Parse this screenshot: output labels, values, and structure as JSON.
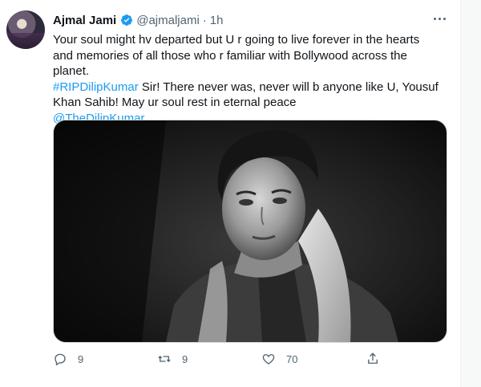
{
  "tweet": {
    "author_name": "Ajmal Jami",
    "handle": "@ajmaljami",
    "separator": "·",
    "time": "1h",
    "text_part1": "Your soul might hv departed but U r going to live forever in the hearts and memories of all those who r familiar with Bollywood across the planet.",
    "hashtag": "#RIPDilipKumar",
    "text_part2": " Sir! There never was, never will b anyone like U, Yousuf Khan Sahib! May ur soul rest in eternal peace",
    "mention": "@TheDilipKumar"
  },
  "actions": {
    "reply_count": "9",
    "retweet_count": "9",
    "like_count": "70"
  },
  "colors": {
    "link": "#1d9bf0",
    "secondary_text": "#536471",
    "verified": "#1d9bf0"
  },
  "icons": [
    "verified-badge-icon",
    "more-options-icon",
    "reply-icon",
    "retweet-icon",
    "like-icon",
    "share-icon"
  ]
}
